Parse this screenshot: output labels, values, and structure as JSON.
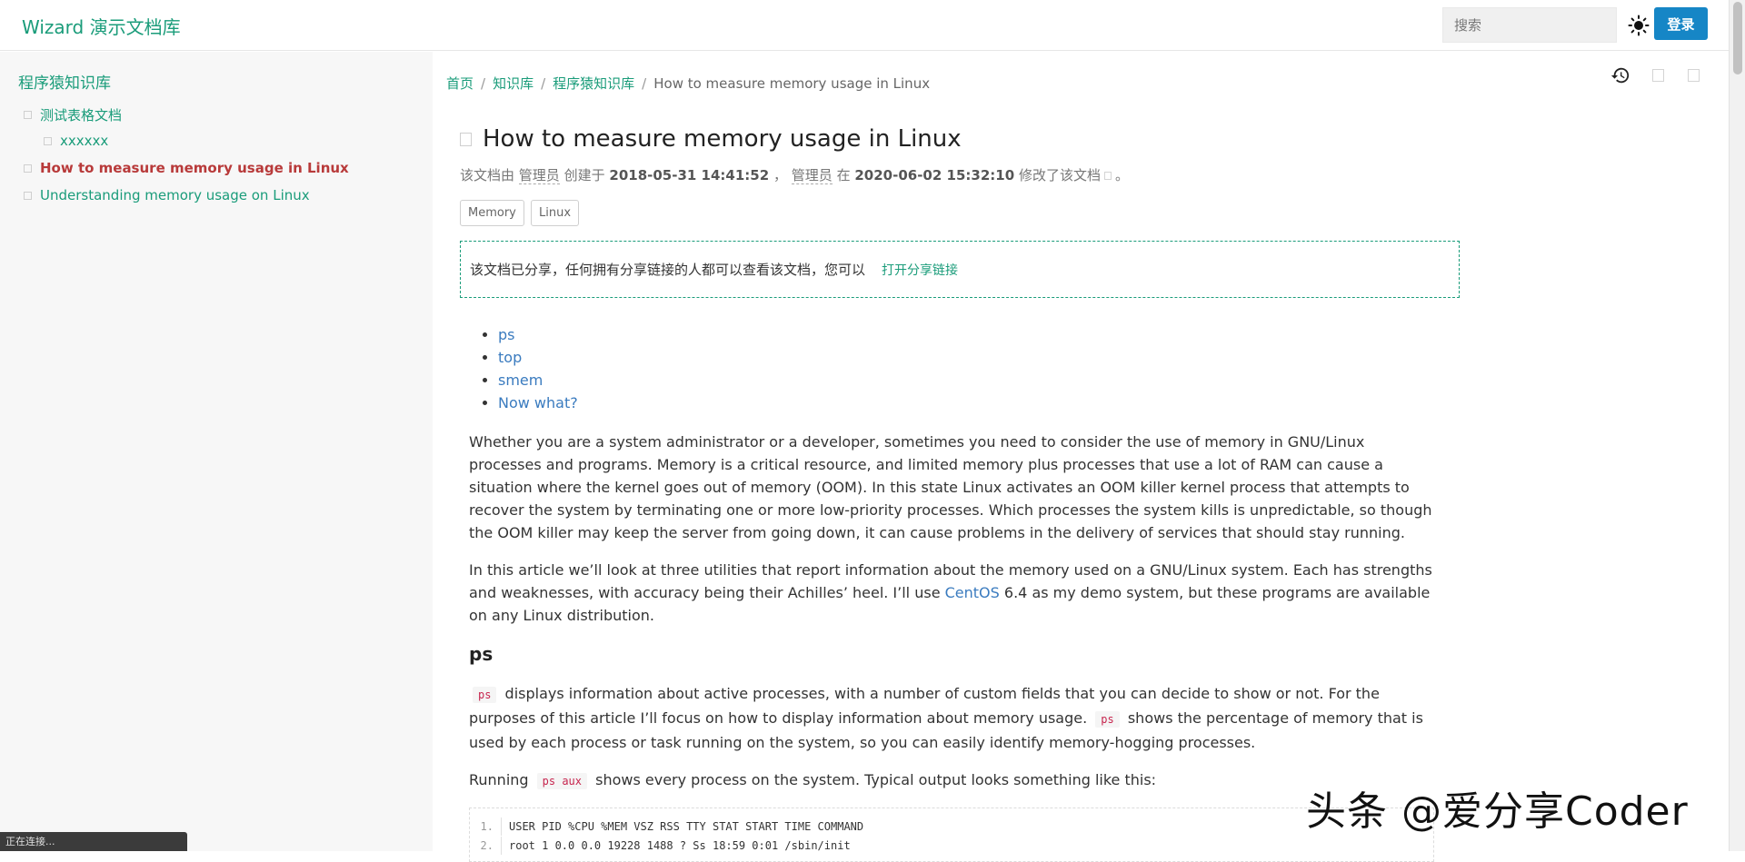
{
  "header": {
    "brand": "Wizard 演示文档库",
    "search_placeholder": "搜索",
    "login_label": "登录"
  },
  "sidebar": {
    "title": "程序猿知识库",
    "items": [
      {
        "label": "测试表格文档",
        "level": 1,
        "active": false
      },
      {
        "label": "xxxxxx",
        "level": 2,
        "active": false
      },
      {
        "label": "How to measure memory usage in Linux",
        "level": 1,
        "active": true
      },
      {
        "label": "Understanding memory usage on Linux",
        "level": 1,
        "active": false
      }
    ]
  },
  "breadcrumb": {
    "items": [
      "首页",
      "知识库",
      "程序猿知识库"
    ],
    "current": "How to measure memory usage in Linux"
  },
  "document": {
    "title": "How to measure memory usage in Linux",
    "meta": {
      "prefix": "该文档由",
      "creator": "管理员",
      "created_label": "创建于",
      "created_at": "2018-05-31 14:41:52",
      "separator": "，",
      "modifier": "管理员",
      "modified_label": "在",
      "modified_at": "2020-06-02 15:32:10",
      "modified_suffix": "修改了该文档",
      "end": "。"
    },
    "tags": [
      "Memory",
      "Linux"
    ],
    "share": {
      "text": "该文档已分享，任何拥有分享链接的人都可以查看该文档，您可以",
      "link_label": "打开分享链接"
    }
  },
  "article": {
    "toc": [
      "ps",
      "top",
      "smem",
      "Now what?"
    ],
    "para1": "Whether you are a system administrator or a developer, sometimes you need to consider the use of memory in GNU/Linux processes and programs. Memory is a critical resource, and limited memory plus processes that use a lot of RAM can cause a situation where the kernel goes out of memory (OOM). In this state Linux activates an OOM killer kernel process that attempts to recover the system by terminating one or more low-priority processes. Which processes the system kills is unpredictable, so though the OOM killer may keep the server from going down, it can cause problems in the delivery of services that should stay running.",
    "para2_a": "In this article we’ll look at three utilities that report information about the memory used on a GNU/Linux system. Each has strengths and weaknesses, with accuracy being their Achilles’ heel. I’ll use",
    "para2_link": "CentOS",
    "para2_b": "6.4 as my demo system, but these programs are available on any Linux distribution.",
    "section1_heading": "ps",
    "para3_code1": "ps",
    "para3_a": "displays information about active processes, with a number of custom fields that you can decide to show or not. For the purposes of this article I’ll focus on how to display information about memory usage.",
    "para3_code2": "ps",
    "para3_b": "shows the percentage of memory that is used by each process or task running on the system, so you can easily identify memory-hogging processes.",
    "para4_a": "Running",
    "para4_code": "ps aux",
    "para4_b": "shows every process on the system. Typical output looks something like this:",
    "code_lines": [
      {
        "num": "1.",
        "text": "USER PID %CPU %MEM VSZ RSS TTY STAT START TIME COMMAND"
      },
      {
        "num": "2.",
        "text": "root 1 0.0 0.0 19228 1488 ? Ss 18:59 0:01 /sbin/init"
      }
    ]
  },
  "watermark": "头条 @爱分享Coder",
  "status_bar": "正在连接..."
}
